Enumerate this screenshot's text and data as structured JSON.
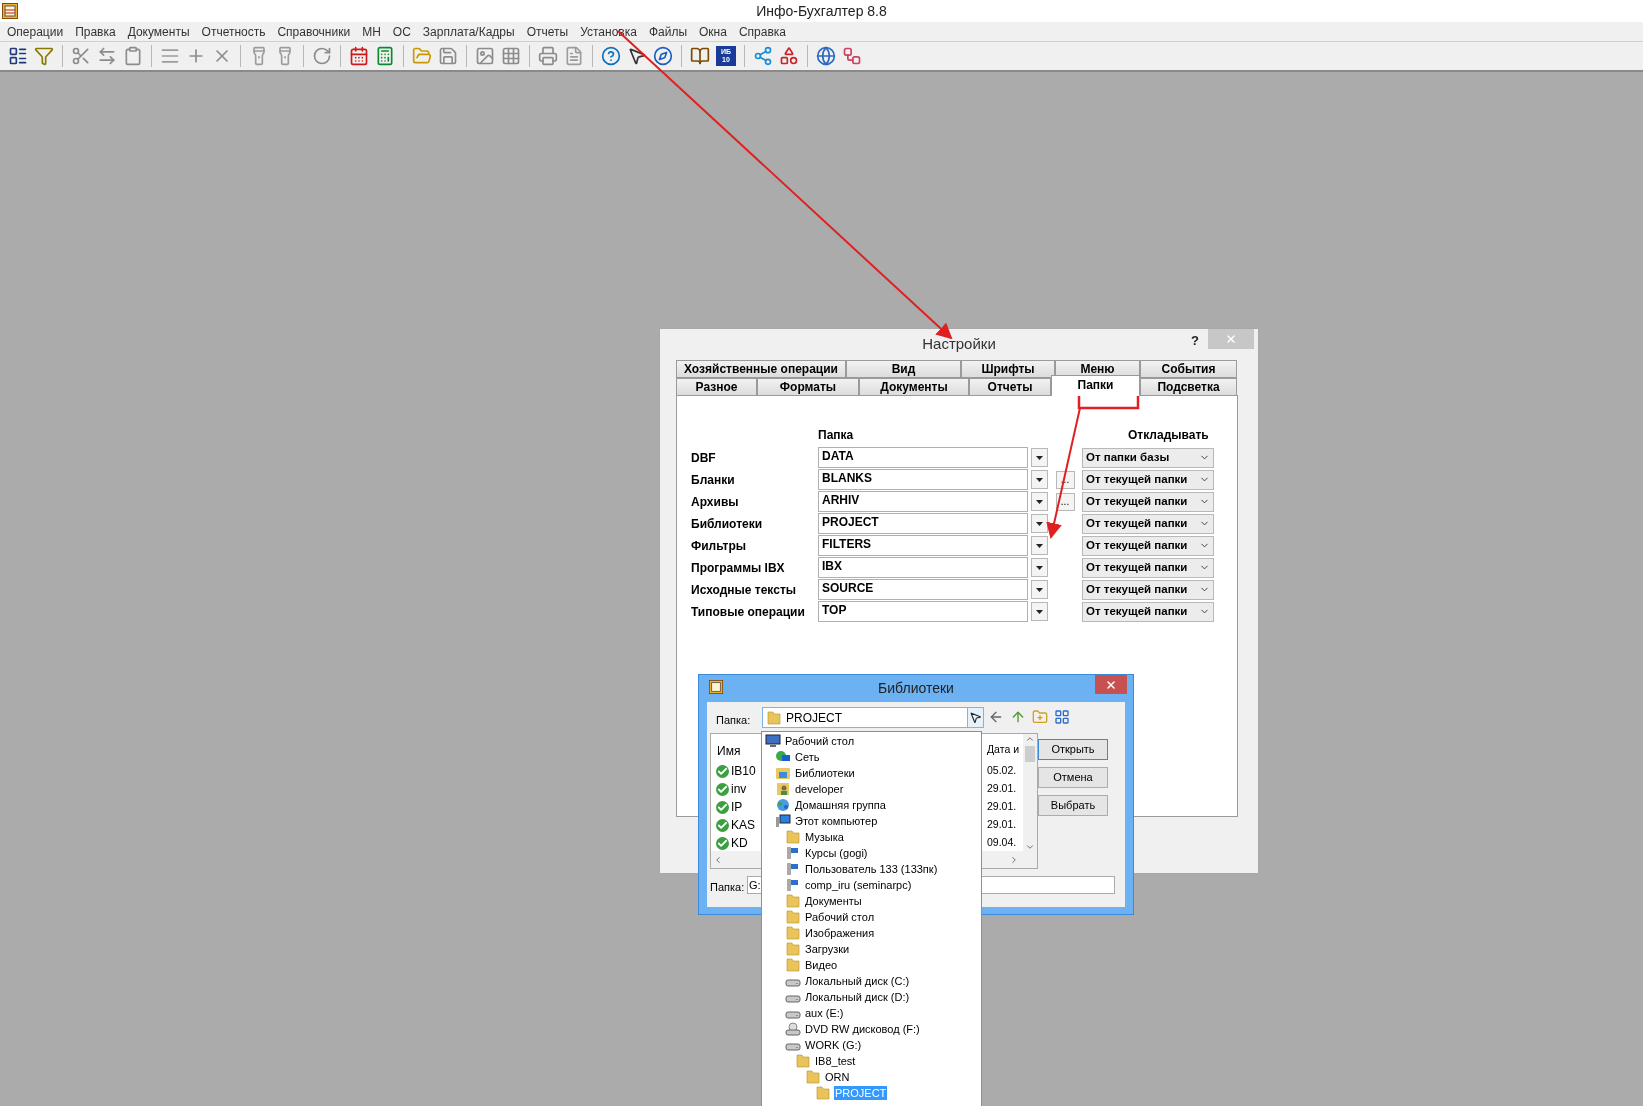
{
  "app_title": "Инфо-Бухгалтер 8.8",
  "menu": [
    "Операции",
    "Правка",
    "Документы",
    "Отчетность",
    "Справочники",
    "МН",
    "ОС",
    "Зарплата/Кадры",
    "Отчеты",
    "Установка",
    "Файлы",
    "Окна",
    "Справка"
  ],
  "toolbar_badge": {
    "line1": "ИБ",
    "line2": "10"
  },
  "settings": {
    "title": "Настройки",
    "help": "?",
    "tabs_row1": [
      {
        "label": "Хозяйственные операции",
        "selected": false
      },
      {
        "label": "Вид",
        "selected": false
      },
      {
        "label": "Шрифты",
        "selected": false
      },
      {
        "label": "Меню",
        "selected": false
      },
      {
        "label": "События",
        "selected": false
      }
    ],
    "tabs_row2": [
      {
        "label": "Разное",
        "selected": false
      },
      {
        "label": "Форматы",
        "selected": false
      },
      {
        "label": "Документы",
        "selected": false
      },
      {
        "label": "Отчеты",
        "selected": false
      },
      {
        "label": "Папки",
        "selected": true
      },
      {
        "label": "Подсветка",
        "selected": false
      }
    ],
    "column_folder": "Папка",
    "column_defer": "Откладывать",
    "rows": [
      {
        "label": "DBF",
        "folder": "DATA",
        "defer": "От папки базы"
      },
      {
        "label": "Бланки",
        "folder": "BLANKS",
        "browse": "...",
        "defer": "От текущей папки"
      },
      {
        "label": "Архивы",
        "folder": "ARHIV",
        "browse": "...",
        "defer": "От текущей папки"
      },
      {
        "label": "Библиотеки",
        "folder": "PROJECT",
        "defer": "От текущей папки"
      },
      {
        "label": "Фильтры",
        "folder": "FILTERS",
        "defer": "От текущей папки"
      },
      {
        "label": "Программы IBX",
        "folder": "IBX",
        "defer": "От текущей папки"
      },
      {
        "label": "Исходные тексты",
        "folder": "SOURCE",
        "defer": "От текущей папки"
      },
      {
        "label": "Типовые операции",
        "folder": "TOP",
        "defer": "От текущей папки"
      }
    ]
  },
  "file_dialog": {
    "title": "Библиотеки",
    "folder_label": "Папка:",
    "folder_value": "PROJECT",
    "columns": [
      "Имя",
      "Дата и"
    ],
    "files": [
      {
        "name": "IB10",
        "date": "05.02."
      },
      {
        "name": "inv",
        "date": "29.01."
      },
      {
        "name": "IP",
        "date": "29.01."
      },
      {
        "name": "KAS",
        "date": "29.01."
      },
      {
        "name": "KD",
        "date": "09.04."
      }
    ],
    "buttons": [
      "Открыть",
      "Отмена",
      "Выбрать"
    ],
    "bottom_label": "Папка:",
    "bottom_value": "G:"
  },
  "folder_tree": [
    {
      "name": "Рабочий стол",
      "kind": "desktop",
      "selected": false,
      "children": [
        {
          "name": "Сеть",
          "kind": "network",
          "selected": false
        },
        {
          "name": "Библиотеки",
          "kind": "libraries",
          "selected": false
        },
        {
          "name": "developer",
          "kind": "user",
          "selected": false
        },
        {
          "name": "Домашняя группа",
          "kind": "homegroup",
          "selected": false
        },
        {
          "name": "Этот компьютер",
          "kind": "computer",
          "selected": false,
          "children": [
            {
              "name": "Музыка",
              "kind": "folder",
              "selected": false
            },
            {
              "name": "Курсы (gogi)",
              "kind": "netdrive",
              "selected": false
            },
            {
              "name": "Пользователь 133 (133пк)",
              "kind": "netdrive",
              "selected": false
            },
            {
              "name": "comp_iru (seminarpc)",
              "kind": "netdrive",
              "selected": false
            },
            {
              "name": "Документы",
              "kind": "folder",
              "selected": false
            },
            {
              "name": "Рабочий стол",
              "kind": "folder",
              "selected": false
            },
            {
              "name": "Изображения",
              "kind": "folder",
              "selected": false
            },
            {
              "name": "Загрузки",
              "kind": "folder",
              "selected": false
            },
            {
              "name": "Видео",
              "kind": "folder",
              "selected": false
            },
            {
              "name": "Локальный диск (C:)",
              "kind": "drive",
              "selected": false
            },
            {
              "name": "Локальный диск (D:)",
              "kind": "drive",
              "selected": false
            },
            {
              "name": "aux (E:)",
              "kind": "drive",
              "selected": false
            },
            {
              "name": "DVD RW дисковод (F:)",
              "kind": "dvd",
              "selected": false
            },
            {
              "name": "WORK (G:)",
              "kind": "drive",
              "selected": false,
              "children": [
                {
                  "name": "IB8_test",
                  "kind": "folder",
                  "selected": false,
                  "children": [
                    {
                      "name": "ORN",
                      "kind": "folder",
                      "selected": false,
                      "children": [
                        {
                          "name": "PROJECT",
                          "kind": "folder",
                          "selected": true
                        }
                      ]
                    }
                  ]
                }
              ]
            }
          ]
        }
      ]
    }
  ]
}
